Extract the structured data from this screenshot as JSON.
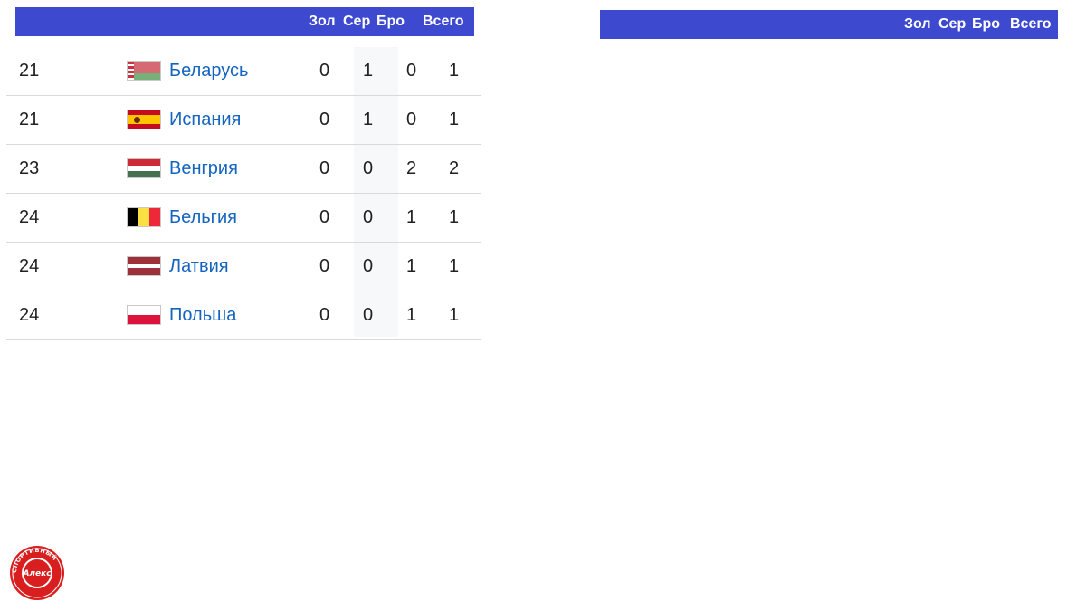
{
  "table_header": {
    "gold": "Зол",
    "silver": "Сер",
    "bronze": "Бро",
    "total": "Всего"
  },
  "rows": [
    {
      "rank": "21",
      "country": "Беларусь",
      "flag": "belarus-flag-icon",
      "gold": "0",
      "silver": "1",
      "bronze": "0",
      "total": "1"
    },
    {
      "rank": "21",
      "country": "Испания",
      "flag": "spain-flag-icon",
      "gold": "0",
      "silver": "1",
      "bronze": "0",
      "total": "1"
    },
    {
      "rank": "23",
      "country": "Венгрия",
      "flag": "hungary-flag-icon",
      "gold": "0",
      "silver": "0",
      "bronze": "2",
      "total": "2"
    },
    {
      "rank": "24",
      "country": "Бельгия",
      "flag": "belgium-flag-icon",
      "gold": "0",
      "silver": "0",
      "bronze": "1",
      "total": "1"
    },
    {
      "rank": "24",
      "country": "Латвия",
      "flag": "latvia-flag-icon",
      "gold": "0",
      "silver": "0",
      "bronze": "1",
      "total": "1"
    },
    {
      "rank": "24",
      "country": "Польша",
      "flag": "poland-flag-icon",
      "gold": "0",
      "silver": "0",
      "bronze": "1",
      "total": "1"
    }
  ],
  "logo": {
    "icon": "sport-logo-icon",
    "text": "Алекс",
    "ring_text": "СПОРТИВНЫЙ"
  },
  "colors": {
    "header": "#3d4ad0",
    "link": "#1565c0",
    "logo_red": "#d81e1e"
  }
}
